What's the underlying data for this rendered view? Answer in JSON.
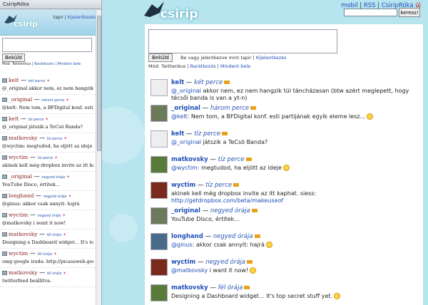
{
  "sidebar": {
    "window_title": "CsiripRóka",
    "brand": "csirip",
    "user": "tapir",
    "logout": "Kijelentkezés",
    "send_label": "Beküld",
    "mode_label": "Mód:",
    "mode_current": "Twittenkus",
    "mode_friends": "Barátkozós",
    "mode_all": "Mindent bele",
    "items": [
      {
        "user": "kelt",
        "time": "két perce",
        "msg": "@_original akkor nem, ez nem hangzik túl táncházasan"
      },
      {
        "user": "_original",
        "time": "három perce",
        "msg": "@kelt: Nem tom, a BFDigital konf. esti partijának"
      },
      {
        "user": "kelt",
        "time": "tíz perce",
        "msg": "@_original játszik a TeCsö Banda?"
      },
      {
        "user": "matkovsky",
        "time": "tíz perce",
        "msg": "@wyctim: megtudod, ha eljött az ideje"
      },
      {
        "user": "wyctim",
        "time": "tíz perce",
        "msg": "akinek kell még dropbox invite az itt kaphat"
      },
      {
        "user": "_original",
        "time": "negyed órája",
        "msg": "YouTube Disco, értitek..."
      },
      {
        "user": "longhand",
        "time": "negyed órája",
        "msg": "@ginus: akkor csak annyit: hajrá"
      },
      {
        "user": "wyctim",
        "time": "negyed órája",
        "msg": "@matkovsky i want it now!"
      },
      {
        "user": "matkovsky",
        "time": "fél órája",
        "msg": "Designing a Dashboard widget... It's top secret"
      },
      {
        "user": "wyctim",
        "time": "fél órája",
        "msg": "omg google iroda: http://picasaweb.google.com"
      },
      {
        "user": "matkovsky",
        "time": "fél órája",
        "msg": "twitterfeed beállítva."
      }
    ]
  },
  "main": {
    "brand": "csirip",
    "nav": {
      "mobil": "mobil",
      "rss": "RSS",
      "app": "CsiripRóka",
      "new": "új"
    },
    "search_button": "keress!",
    "send_label": "Beküld",
    "logged_in": "Be vagy jelentkezve mint tapir",
    "logout": "Kijelentkezés",
    "mode_label": "Mód:",
    "mode_current": "Twittenkus",
    "mode_friends": "Barátkozós",
    "mode_all": "Mindent bele",
    "feed": [
      {
        "user": "kelt",
        "time": "két perce",
        "at": "@_original",
        "text": " akkor nem, ez nem hangzik túl táncházasan (btw azért meglepett, hogy técsői banda is van a yt-n)",
        "smile": false
      },
      {
        "user": "_original",
        "time": "három perce",
        "at": "@kelt:",
        "text": " Nem tom, a BFDigital konf. esti partijának egyik eleme lesz...",
        "smile": true
      },
      {
        "user": "kelt",
        "time": "tíz perce",
        "at": "@_original",
        "text": " játszik a TeCsö Banda?",
        "smile": false
      },
      {
        "user": "matkovsky",
        "time": "tíz perce",
        "at": "@wyctim:",
        "text": " megtudod, ha eljött az ideje",
        "smile": true
      },
      {
        "user": "wyctim",
        "time": "tíz perce",
        "at": "",
        "text": "akinek kell még dropbox invite az itt kaphat. siess: ",
        "link": "http://getdropbox.com/beta/makeuseof",
        "smile": false
      },
      {
        "user": "_original",
        "time": "negyed órája",
        "at": "",
        "text": "YouTube Disco, értitek...",
        "smile": false
      },
      {
        "user": "longhand",
        "time": "negyed órája",
        "at": "@ginus:",
        "text": " akkor csak annyit: hajrá",
        "smile": true
      },
      {
        "user": "wyctim",
        "time": "negyed órája",
        "at": "@matkovsky",
        "text": " i want it now!",
        "smile": true
      },
      {
        "user": "matkovsky",
        "time": "fél órája",
        "at": "",
        "text": "Designing a Dashboard widget... It's top secret stuff yet.",
        "smile": true
      }
    ]
  }
}
